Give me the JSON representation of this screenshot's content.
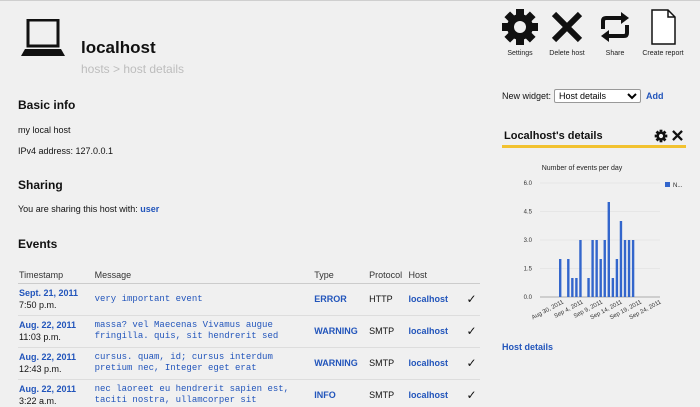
{
  "header": {
    "title": "localhost",
    "breadcrumb": "hosts > host details"
  },
  "basic_info": {
    "title": "Basic info",
    "description": "my local host",
    "ipv4": "IPv4 address: 127.0.0.1"
  },
  "sharing": {
    "title": "Sharing",
    "text": "You are sharing this host with:",
    "user": "user"
  },
  "events": {
    "title": "Events",
    "columns": [
      "Timestamp",
      "Message",
      "Type",
      "Protocol",
      "Host"
    ],
    "rows": [
      {
        "date": "Sept. 21, 2011",
        "time": "7:50 p.m.",
        "message": "very important event",
        "type": "ERROR",
        "protocol": "HTTP",
        "host": "localhost",
        "check": "✓"
      },
      {
        "date": "Aug. 22, 2011",
        "time": "11:03 p.m.",
        "message": "massa? vel Maecenas Vivamus augue fringilla. quis, sit hendrerit sed",
        "type": "WARNING",
        "protocol": "SMTP",
        "host": "localhost",
        "check": "✓"
      },
      {
        "date": "Aug. 22, 2011",
        "time": "12:43 p.m.",
        "message": "cursus. quam, id; cursus interdum pretium nec, Integer eget erat",
        "type": "WARNING",
        "protocol": "SMTP",
        "host": "localhost",
        "check": "✓"
      },
      {
        "date": "Aug. 22, 2011",
        "time": "3:22 a.m.",
        "message": "nec laoreet eu hendrerit sapien est, taciti nostra, ullamcorper sit",
        "type": "INFO",
        "protocol": "SMTP",
        "host": "localhost",
        "check": "✓"
      }
    ]
  },
  "toolbar": {
    "settings": "Settings",
    "delete": "Delete host",
    "share": "Share",
    "report": "Create report"
  },
  "new_widget": {
    "label": "New widget:",
    "selected": "Host details",
    "add": "Add"
  },
  "widget": {
    "title": "Localhost's details",
    "link": "Host details"
  },
  "colors": {
    "link": "#2255bb",
    "bar": "#3366cc",
    "widget_underline": "#f2c230"
  },
  "chart_data": {
    "type": "bar",
    "title": "Number of events per day",
    "ylim": [
      0,
      6
    ],
    "yticks": [
      "0.0",
      "1.5",
      "3.0",
      "4.5",
      "6.0"
    ],
    "xticks": [
      "Aug 30, 2011",
      "Sep 4, 2011",
      "Sep 9, 2011",
      "Sep 14, 2011",
      "Sep 19, 2011",
      "Sep 24, 2011"
    ],
    "legend": "N...",
    "legend_position": "top-right",
    "values": [
      2,
      0,
      2,
      1,
      1,
      3,
      0,
      1,
      3,
      3,
      2,
      3,
      5,
      1,
      2,
      4,
      3,
      3,
      3
    ]
  }
}
